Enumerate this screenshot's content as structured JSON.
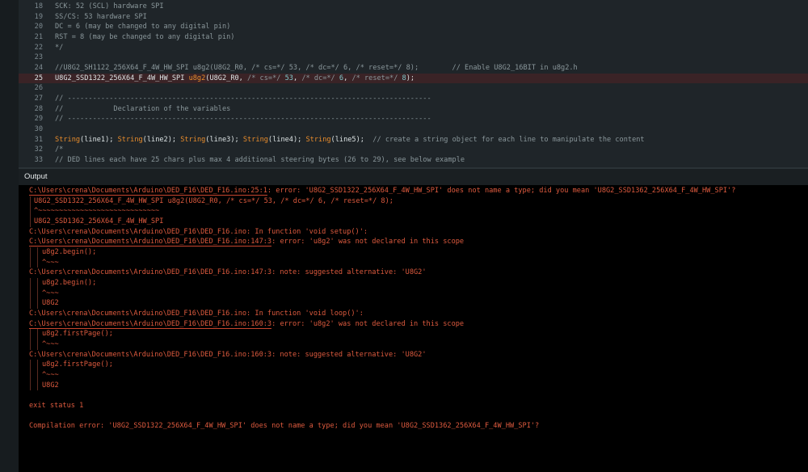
{
  "editor": {
    "current_line": 25,
    "lines": [
      {
        "n": 18,
        "tokens": [
          [
            "com",
            "SCK: 52 (SCL) hardware SPI"
          ]
        ]
      },
      {
        "n": 19,
        "tokens": [
          [
            "com",
            "SS/CS: 53 hardware SPI"
          ]
        ]
      },
      {
        "n": 20,
        "tokens": [
          [
            "com",
            "DC = 6 (may be changed to any digital pin)"
          ]
        ]
      },
      {
        "n": 21,
        "tokens": [
          [
            "com",
            "RST = 8 (may be changed to any digital pin)"
          ]
        ]
      },
      {
        "n": 22,
        "tokens": [
          [
            "com",
            "*/"
          ]
        ]
      },
      {
        "n": 23,
        "tokens": []
      },
      {
        "n": 24,
        "tokens": [
          [
            "com",
            "//U8G2_SH1122_256X64_F_4W_HW_SPI u8g2(U8G2_R0, /* cs=*/ 53, /* dc=*/ 6, /* reset=*/ 8);        // Enable U8G2_16BIT in u8g2.h"
          ]
        ]
      },
      {
        "n": 25,
        "tokens": [
          [
            "txt",
            "U8G2_SSD1322_256X64_F_4W_HW_SPI "
          ],
          [
            "fn",
            "u8g2"
          ],
          [
            "txt",
            "(U8G2_R0, "
          ],
          [
            "com",
            "/* cs=*/ "
          ],
          [
            "num",
            "53"
          ],
          [
            "txt",
            ", "
          ],
          [
            "com",
            "/* dc=*/ "
          ],
          [
            "num",
            "6"
          ],
          [
            "txt",
            ", "
          ],
          [
            "com",
            "/* reset=*/ "
          ],
          [
            "num",
            "8"
          ],
          [
            "txt",
            ");"
          ]
        ]
      },
      {
        "n": 26,
        "tokens": []
      },
      {
        "n": 27,
        "tokens": [
          [
            "com",
            "// ---------------------------------------------------------------------------------------"
          ]
        ]
      },
      {
        "n": 28,
        "tokens": [
          [
            "com",
            "//            Declaration of the variables"
          ]
        ]
      },
      {
        "n": 29,
        "tokens": [
          [
            "com",
            "// ---------------------------------------------------------------------------------------"
          ]
        ]
      },
      {
        "n": 30,
        "tokens": []
      },
      {
        "n": 31,
        "tokens": [
          [
            "fn",
            "String"
          ],
          [
            "txt",
            "(line1); "
          ],
          [
            "fn",
            "String"
          ],
          [
            "txt",
            "(line2); "
          ],
          [
            "fn",
            "String"
          ],
          [
            "txt",
            "(line3); "
          ],
          [
            "fn",
            "String"
          ],
          [
            "txt",
            "(line4); "
          ],
          [
            "fn",
            "String"
          ],
          [
            "txt",
            "(line5);  "
          ],
          [
            "com",
            "// create a string object for each line to manipulate the content"
          ]
        ]
      },
      {
        "n": 32,
        "tokens": [
          [
            "com",
            "/*"
          ]
        ]
      },
      {
        "n": 33,
        "tokens": [
          [
            "com",
            "// DED lines each have 25 chars plus max 4 additional steering bytes (26 to 29), see below example"
          ]
        ]
      }
    ]
  },
  "output": {
    "title": "Output",
    "lines": [
      {
        "lvl": 0,
        "ul": "C:\\Users\\crena\\Documents\\Arduino\\DED_F16\\DED_F16.ino:25:1",
        "text": ": error: 'U8G2_SSD1322_256X64_F_4W_HW_SPI' does not name a type; did you mean 'U8G2_SSD1362_256X64_F_4W_HW_SPI'?"
      },
      {
        "lvl": 1,
        "text": "U8G2_SSD1322_256X64_F_4W_HW_SPI u8g2(U8G2_R0, /* cs=*/ 53, /* dc=*/ 6, /* reset=*/ 8);"
      },
      {
        "lvl": 1,
        "text": "^~~~~~~~~~~~~~~~~~~~~~~~~~~~~~"
      },
      {
        "lvl": 1,
        "text": "U8G2_SSD1362_256X64_F_4W_HW_SPI"
      },
      {
        "lvl": 0,
        "text": "C:\\Users\\crena\\Documents\\Arduino\\DED_F16\\DED_F16.ino: In function 'void setup()':"
      },
      {
        "lvl": 0,
        "ul": "C:\\Users\\crena\\Documents\\Arduino\\DED_F16\\DED_F16.ino:147:3",
        "text": ": error: 'u8g2' was not declared in this scope"
      },
      {
        "lvl": 2,
        "text": "u8g2.begin();"
      },
      {
        "lvl": 2,
        "text": "^~~~"
      },
      {
        "lvl": 0,
        "text": "C:\\Users\\crena\\Documents\\Arduino\\DED_F16\\DED_F16.ino:147:3: note: suggested alternative: 'U8G2'"
      },
      {
        "lvl": 2,
        "text": "u8g2.begin();"
      },
      {
        "lvl": 2,
        "text": "^~~~"
      },
      {
        "lvl": 2,
        "text": "U8G2"
      },
      {
        "lvl": 0,
        "text": "C:\\Users\\crena\\Documents\\Arduino\\DED_F16\\DED_F16.ino: In function 'void loop()':"
      },
      {
        "lvl": 0,
        "ul": "C:\\Users\\crena\\Documents\\Arduino\\DED_F16\\DED_F16.ino:160:3",
        "text": ": error: 'u8g2' was not declared in this scope"
      },
      {
        "lvl": 2,
        "text": "u8g2.firstPage();"
      },
      {
        "lvl": 2,
        "text": "^~~~"
      },
      {
        "lvl": 0,
        "text": "C:\\Users\\crena\\Documents\\Arduino\\DED_F16\\DED_F16.ino:160:3: note: suggested alternative: 'U8G2'"
      },
      {
        "lvl": 2,
        "text": "u8g2.firstPage();"
      },
      {
        "lvl": 2,
        "text": "^~~~"
      },
      {
        "lvl": 2,
        "text": "U8G2"
      },
      {
        "lvl": 0,
        "text": ""
      },
      {
        "lvl": 0,
        "text": "exit status 1"
      },
      {
        "lvl": 0,
        "text": ""
      },
      {
        "lvl": 0,
        "text": "Compilation error: 'U8G2_SSD1322_256X64_F_4W_HW_SPI' does not name a type; did you mean 'U8G2_SSD1362_256X64_F_4W_HW_SPI'?"
      }
    ]
  },
  "colors": {
    "error": "#dd5a3e",
    "keyword": "#e88c2c",
    "comment": "#8a979b",
    "highlight_line": "#3a2326"
  }
}
